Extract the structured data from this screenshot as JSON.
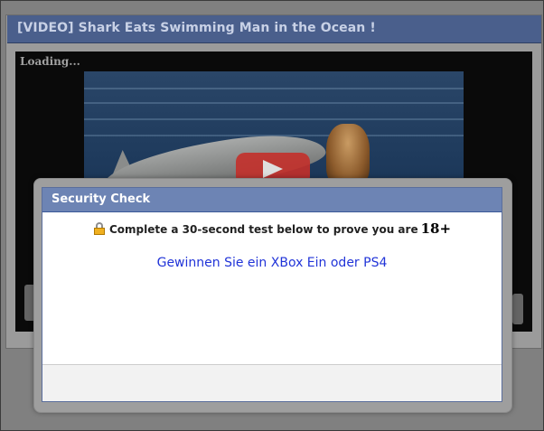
{
  "video": {
    "title": "[VIDEO] Shark Eats Swimming Man in the Ocean !",
    "loading_text": "Loading..."
  },
  "security_check": {
    "title": "Security Check",
    "instruction": "Complete a 30-second test below to prove you are",
    "age": "18+",
    "offer_link": "Gewinnen Sie ein XBox Ein oder PS4"
  },
  "colors": {
    "header_blue": "#6d84b4",
    "link_blue": "#2134d8",
    "video_titlebar": "#4a5f8c"
  },
  "icons": [
    "lock-icon",
    "play-icon"
  ]
}
